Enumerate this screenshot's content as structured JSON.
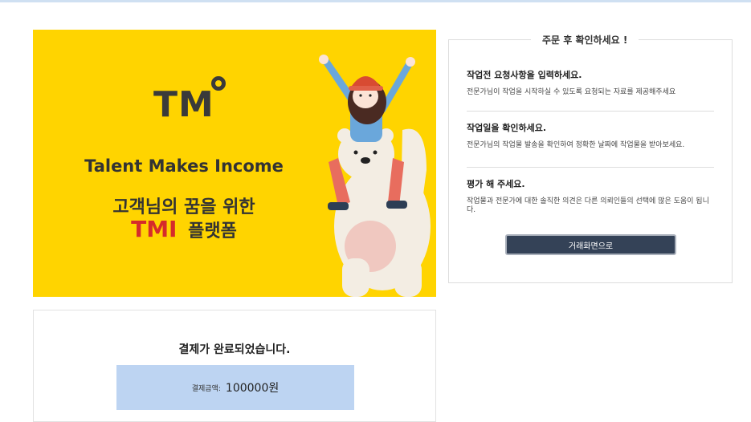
{
  "banner": {
    "logo_text": "TM",
    "tagline": "Talent Makes Income",
    "korean_line1": "고객님의 꿈을 위한",
    "korean_tmi": "TMI",
    "korean_platform": "플랫폼",
    "accent_color": "#FFD400",
    "tmi_color": "#D52B2B"
  },
  "panel": {
    "title": "주문 후 확인하세요 !",
    "sections": [
      {
        "heading": "작업전 요청사항을 입력하세요.",
        "text": "전문가님이 작업을 시작하실 수 있도록 요청되는 자료를 제공해주세요"
      },
      {
        "heading": "작업일을 확인하세요.",
        "text": "전문가님의 작업물 발송을 확인하여 정확한 날짜에 작업물을 받아보세요."
      },
      {
        "heading": "평가 해 주세요.",
        "text": "작업물과 전문가에 대한 솔직한 의견은 다른 의뢰인들의 선택에 많은 도움이 됩니다."
      }
    ],
    "button_label": "거래화면으로"
  },
  "payment": {
    "title": "결제가 완료되었습니다.",
    "amount_label": "결제금액:",
    "amount_value": "100000원"
  }
}
